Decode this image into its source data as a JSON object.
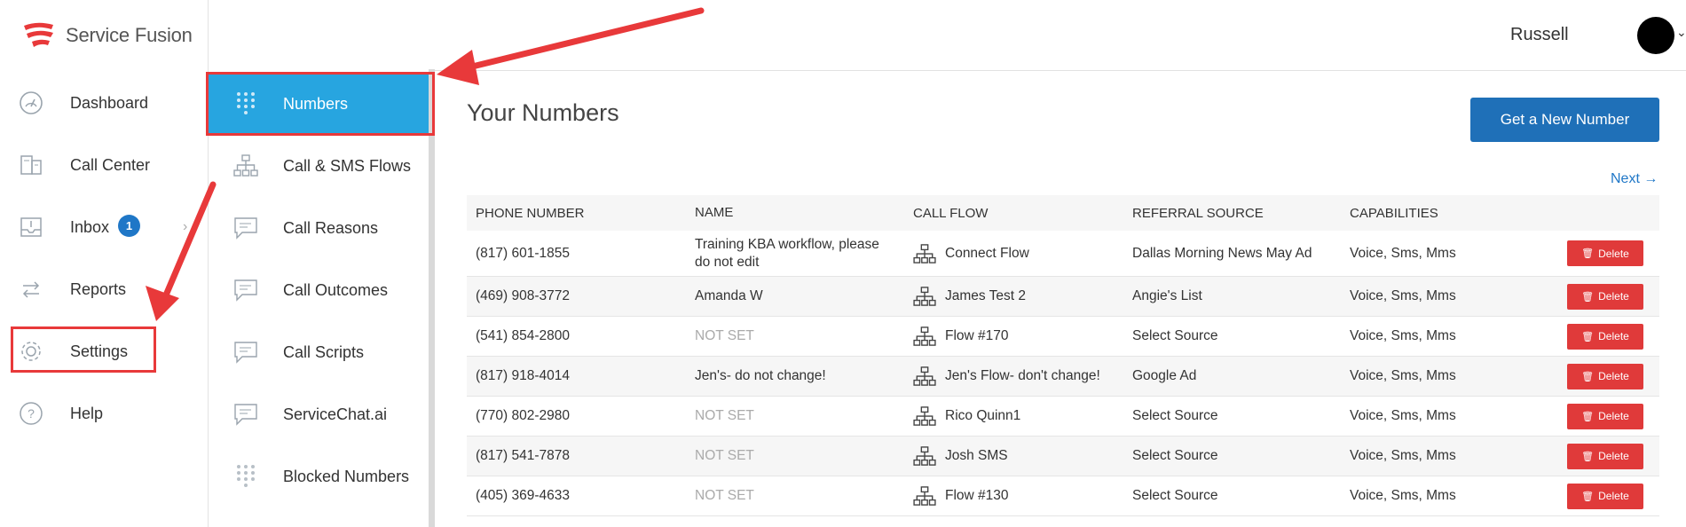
{
  "app": {
    "brand": "Service Fusion"
  },
  "user": {
    "name": "Russell"
  },
  "sidebar": {
    "items": [
      {
        "label": "Dashboard",
        "icon": "dashboard-gauge-icon"
      },
      {
        "label": "Call Center",
        "icon": "call-center-icon"
      },
      {
        "label": "Inbox",
        "icon": "inbox-icon",
        "badge": "1"
      },
      {
        "label": "Reports",
        "icon": "reports-arrows-icon"
      },
      {
        "label": "Settings",
        "icon": "gear-icon"
      },
      {
        "label": "Help",
        "icon": "help-icon"
      }
    ]
  },
  "subnav": {
    "items": [
      {
        "label": "Numbers",
        "active": true
      },
      {
        "label": "Call & SMS Flows"
      },
      {
        "label": "Call Reasons"
      },
      {
        "label": "Call Outcomes"
      },
      {
        "label": "Call Scripts"
      },
      {
        "label": "ServiceChat.ai"
      },
      {
        "label": "Blocked Numbers"
      }
    ]
  },
  "main": {
    "title": "Your Numbers",
    "new_number_button": "Get a New Number",
    "next_link": "Next →",
    "table": {
      "headers": [
        "PHONE NUMBER",
        "NAME",
        "CALL FLOW",
        "REFERRAL SOURCE",
        "CAPABILITIES"
      ],
      "delete_label": "Delete",
      "rows": [
        {
          "phone": "(817) 601-1855",
          "name": "Training KBA workflow, please do not edit",
          "flow": "Connect Flow",
          "referral": "Dallas Morning News May Ad",
          "capabilities": "Voice, Sms, Mms"
        },
        {
          "phone": "(469) 908-3772",
          "name": "Amanda W",
          "flow": "James Test 2",
          "referral": "Angie's List",
          "capabilities": "Voice, Sms, Mms"
        },
        {
          "phone": "(541) 854-2800",
          "name": "NOT SET",
          "flow": "Flow #170",
          "referral": "Select Source",
          "capabilities": "Voice, Sms, Mms"
        },
        {
          "phone": "(817) 918-4014",
          "name": "Jen's- do not change!",
          "flow": "Jen's Flow- don't change!",
          "referral": "Google Ad",
          "capabilities": "Voice, Sms, Mms"
        },
        {
          "phone": "(770) 802-2980",
          "name": "NOT SET",
          "flow": "Rico Quinn1",
          "referral": "Select Source",
          "capabilities": "Voice, Sms, Mms"
        },
        {
          "phone": "(817) 541-7878",
          "name": "NOT SET",
          "flow": "Josh SMS",
          "referral": "Select Source",
          "capabilities": "Voice, Sms, Mms"
        },
        {
          "phone": "(405) 369-4633",
          "name": "NOT SET",
          "flow": "Flow #130",
          "referral": "Select Source",
          "capabilities": "Voice, Sms, Mms"
        }
      ]
    }
  },
  "colors": {
    "accent": "#27a5e0",
    "primary_button": "#1f70b8",
    "danger": "#e03a3a",
    "annotation": "#e8393a"
  }
}
